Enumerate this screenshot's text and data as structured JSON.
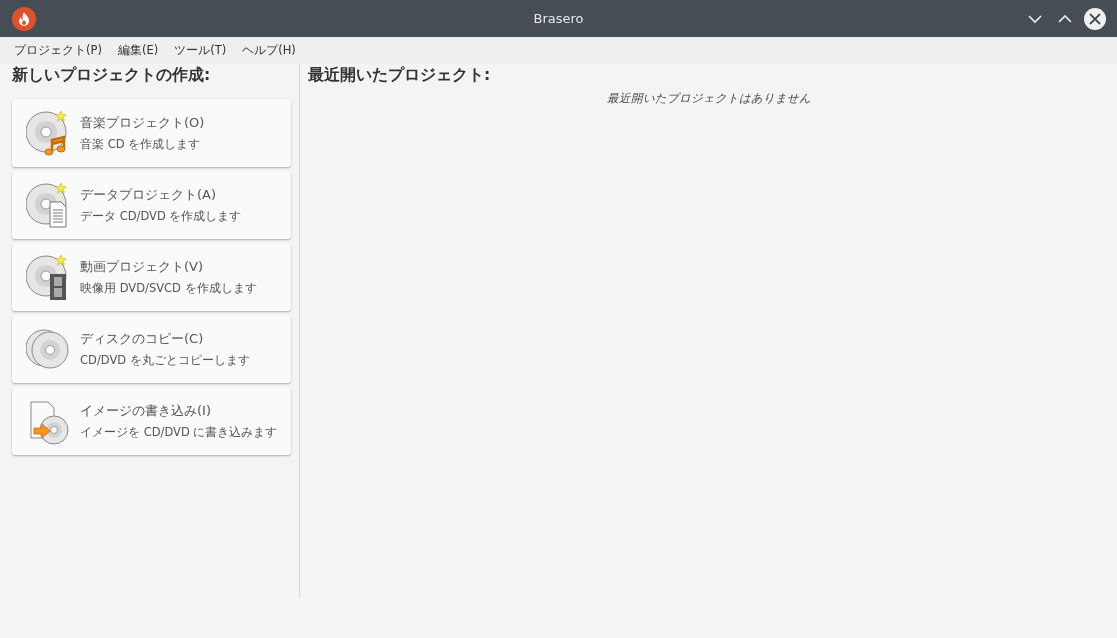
{
  "window": {
    "title": "Brasero"
  },
  "menu": [
    "プロジェクト(P)",
    "編集(E)",
    "ツール(T)",
    "ヘルプ(H)"
  ],
  "new_project": {
    "heading": "新しいプロジェクトの作成:",
    "items": [
      {
        "kind": "audio",
        "title": "音楽プロジェクト(O)",
        "description": "音楽 CD を作成します"
      },
      {
        "kind": "data",
        "title": "データプロジェクト(A)",
        "description": "データ CD/DVD を作成します"
      },
      {
        "kind": "video",
        "title": "動画プロジェクト(V)",
        "description": "映像用 DVD/SVCD を作成します"
      },
      {
        "kind": "copy",
        "title": "ディスクのコピー(C)",
        "description": "CD/DVD を丸ごとコピーします"
      },
      {
        "kind": "image",
        "title": "イメージの書き込み(I)",
        "description": "イメージを CD/DVD に書き込みます"
      }
    ]
  },
  "recent": {
    "heading": "最近開いたプロジェクト:",
    "empty_message": "最近開いたプロジェクトはありません"
  }
}
